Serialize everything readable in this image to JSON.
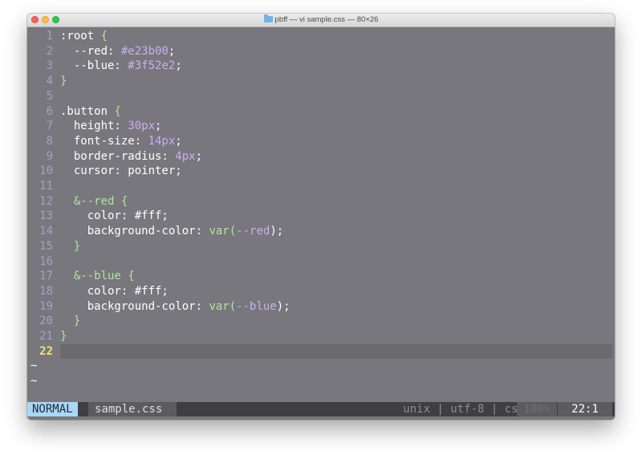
{
  "window": {
    "title": "pbff — vi sample.css — 80×26"
  },
  "editor": {
    "lines": [
      {
        "num": "1",
        "segments": [
          {
            "t": ":root ",
            "c": "w"
          },
          {
            "t": "{",
            "c": "g"
          }
        ]
      },
      {
        "num": "2",
        "segments": [
          {
            "t": "  --red: ",
            "c": "w"
          },
          {
            "t": "#e23b00",
            "c": "p"
          },
          {
            "t": ";",
            "c": "w"
          }
        ]
      },
      {
        "num": "3",
        "segments": [
          {
            "t": "  --blue: ",
            "c": "w"
          },
          {
            "t": "#3f52e2",
            "c": "p"
          },
          {
            "t": ";",
            "c": "w"
          }
        ]
      },
      {
        "num": "4",
        "segments": [
          {
            "t": "}",
            "c": "g"
          }
        ]
      },
      {
        "num": "5",
        "segments": []
      },
      {
        "num": "6",
        "segments": [
          {
            "t": ".button ",
            "c": "w"
          },
          {
            "t": "{",
            "c": "g"
          }
        ]
      },
      {
        "num": "7",
        "segments": [
          {
            "t": "  height: ",
            "c": "w"
          },
          {
            "t": "30px",
            "c": "p"
          },
          {
            "t": ";",
            "c": "w"
          }
        ]
      },
      {
        "num": "8",
        "segments": [
          {
            "t": "  font-size: ",
            "c": "w"
          },
          {
            "t": "14px",
            "c": "p"
          },
          {
            "t": ";",
            "c": "w"
          }
        ]
      },
      {
        "num": "9",
        "segments": [
          {
            "t": "  border-radius: ",
            "c": "w"
          },
          {
            "t": "4px",
            "c": "p"
          },
          {
            "t": ";",
            "c": "w"
          }
        ]
      },
      {
        "num": "10",
        "segments": [
          {
            "t": "  cursor: pointer;",
            "c": "w"
          }
        ]
      },
      {
        "num": "11",
        "segments": []
      },
      {
        "num": "12",
        "segments": [
          {
            "t": "  &--red ",
            "c": "g"
          },
          {
            "t": "{",
            "c": "g"
          }
        ]
      },
      {
        "num": "13",
        "segments": [
          {
            "t": "    color: #fff;",
            "c": "w"
          }
        ]
      },
      {
        "num": "14",
        "segments": [
          {
            "t": "    background-color: ",
            "c": "w"
          },
          {
            "t": "var(",
            "c": "g"
          },
          {
            "t": "--red",
            "c": "p"
          },
          {
            "t": ");",
            "c": "w"
          }
        ]
      },
      {
        "num": "15",
        "segments": [
          {
            "t": "  }",
            "c": "g"
          }
        ]
      },
      {
        "num": "16",
        "segments": []
      },
      {
        "num": "17",
        "segments": [
          {
            "t": "  &--blue ",
            "c": "g"
          },
          {
            "t": "{",
            "c": "g"
          }
        ]
      },
      {
        "num": "18",
        "segments": [
          {
            "t": "    color: #fff;",
            "c": "w"
          }
        ]
      },
      {
        "num": "19",
        "segments": [
          {
            "t": "    background-color: ",
            "c": "w"
          },
          {
            "t": "var(",
            "c": "g"
          },
          {
            "t": "--blue",
            "c": "p"
          },
          {
            "t": ");",
            "c": "w"
          }
        ]
      },
      {
        "num": "20",
        "segments": [
          {
            "t": "  }",
            "c": "g"
          }
        ]
      },
      {
        "num": "21",
        "segments": [
          {
            "t": "}",
            "c": "g"
          }
        ]
      },
      {
        "num": "22",
        "segments": [],
        "current": true
      }
    ],
    "tildes": [
      "~",
      "~"
    ]
  },
  "statusbar": {
    "mode": "NORMAL",
    "filename": "sample.css",
    "info": "unix | utf-8 | css",
    "percent": "100%",
    "position": "22:1"
  },
  "colors": {
    "background": "#77777d",
    "keyword_green": "#b2e59a",
    "value_purple": "#cdaef0",
    "line_number": "#a6a0c6",
    "current_line_number": "#f4e46e",
    "mode_badge": "#a9d7f4"
  }
}
